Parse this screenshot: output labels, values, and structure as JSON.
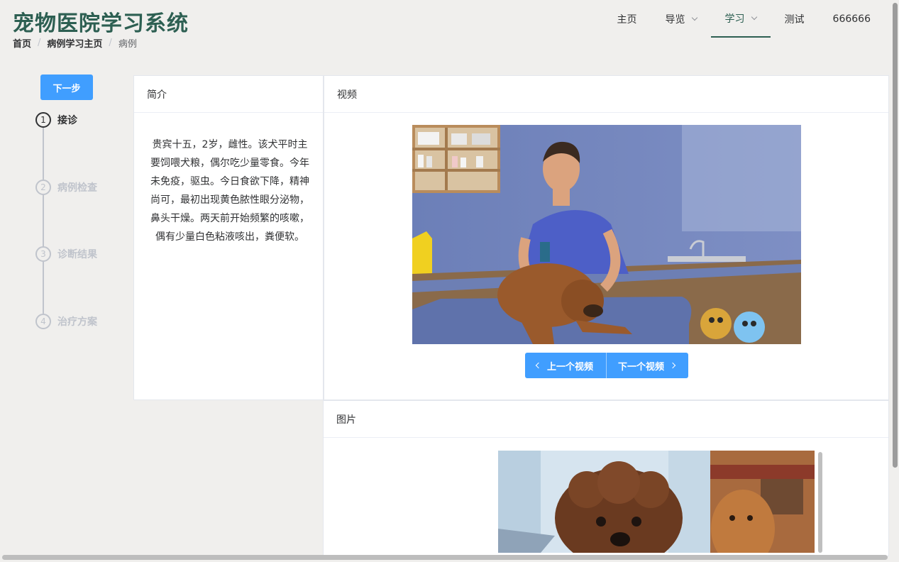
{
  "app": {
    "title": "宠物医院学习系统"
  },
  "breadcrumb": [
    {
      "label": "首页"
    },
    {
      "label": "病例学习主页"
    },
    {
      "label": "病例"
    }
  ],
  "nav": {
    "items": [
      {
        "label": "主页"
      },
      {
        "label": "导览"
      },
      {
        "label": "学习"
      },
      {
        "label": "测试"
      },
      {
        "label": "666666"
      }
    ]
  },
  "steps": {
    "next_button": "下一步",
    "items": [
      {
        "num": "1",
        "label": "接诊"
      },
      {
        "num": "2",
        "label": "病例检查"
      },
      {
        "num": "3",
        "label": "诊断结果"
      },
      {
        "num": "4",
        "label": "治疗方案"
      }
    ],
    "active_index": 0
  },
  "intro": {
    "title": "简介",
    "text": "贵宾十五，2岁，雌性。该犬平时主要饲喂犬粮，偶尔吃少量零食。今年未免疫，驱虫。今日食欲下降，精神尚可，最初出现黄色脓性眼分泌物，鼻头干燥。两天前开始频繁的咳嗽，偶有少量白色粘液咳出，粪便软。"
  },
  "video": {
    "title": "视频",
    "prev_button": "上一个视频",
    "next_button": "下一个视频"
  },
  "images": {
    "title": "图片"
  },
  "colors": {
    "accent": "#409eff",
    "brand": "#2d5f52"
  }
}
